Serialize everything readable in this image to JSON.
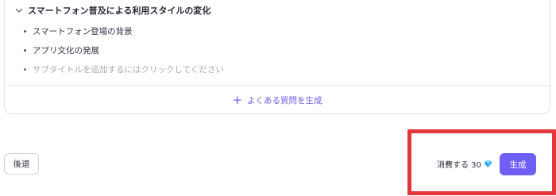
{
  "section": {
    "title": "スマートフォン普及による利用スタイルの変化",
    "items": [
      {
        "label": "スマートフォン登場の背景"
      },
      {
        "label": "アプリ文化の発展"
      }
    ],
    "placeholder": "サブタイトルを追加するにはクリックしてください",
    "partial_next_item": "…"
  },
  "faq": {
    "label": "よくある質問を生成"
  },
  "footer": {
    "back_label": "後退",
    "cost_label": "消費する 30",
    "generate_label": "生成"
  },
  "colors": {
    "accent": "#6f5ff6",
    "highlight": "#e0373c"
  },
  "icons": {
    "collapse": "chevron-down-icon",
    "add": "plus-icon",
    "gem": "diamond-icon"
  }
}
